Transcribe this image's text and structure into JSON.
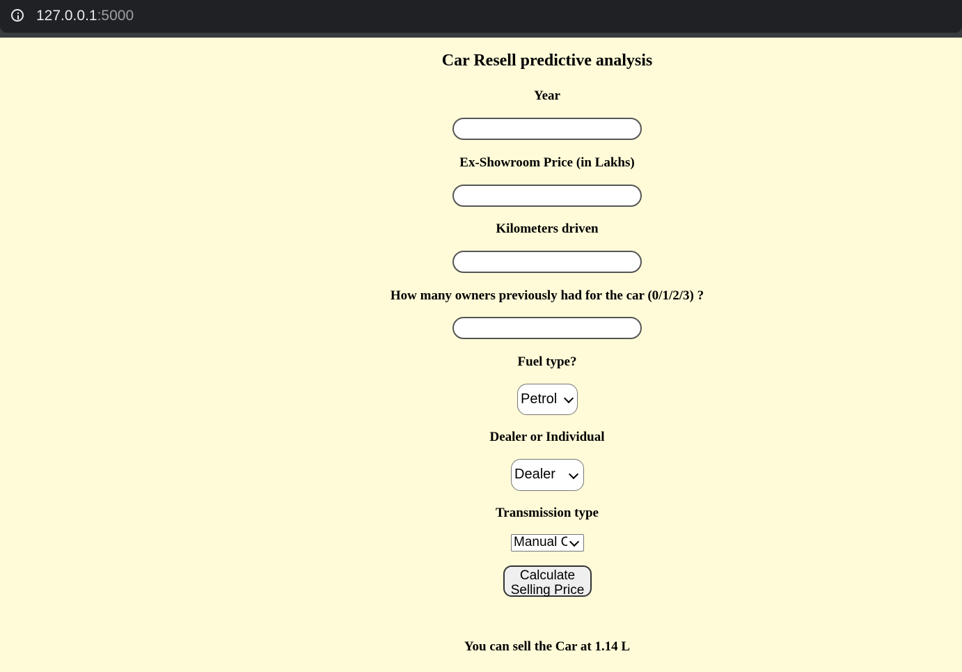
{
  "browser": {
    "url_host": "127.0.0.1",
    "url_port": ":5000"
  },
  "form": {
    "title": "Car Resell predictive analysis",
    "year_label": "Year",
    "year_value": "",
    "price_label": "Ex-Showroom Price (in Lakhs)",
    "price_value": "",
    "km_label": "Kilometers driven",
    "km_value": "",
    "owners_label": "How many owners previously had for the car (0/1/2/3) ?",
    "owners_value": "",
    "fuel_label": "Fuel type?",
    "fuel_selected": "Petrol",
    "seller_label": "Dealer or Individual",
    "seller_selected": "Dealer",
    "transmission_label": "Transmission type",
    "transmission_selected": "Manual Car",
    "submit_label_line1": "Calculate",
    "submit_label_line2": "Selling Price",
    "result_text": "You can sell the Car at 1.14 L"
  },
  "colors": {
    "page_background": "#fffbd8",
    "browser_bar": "#202124"
  }
}
